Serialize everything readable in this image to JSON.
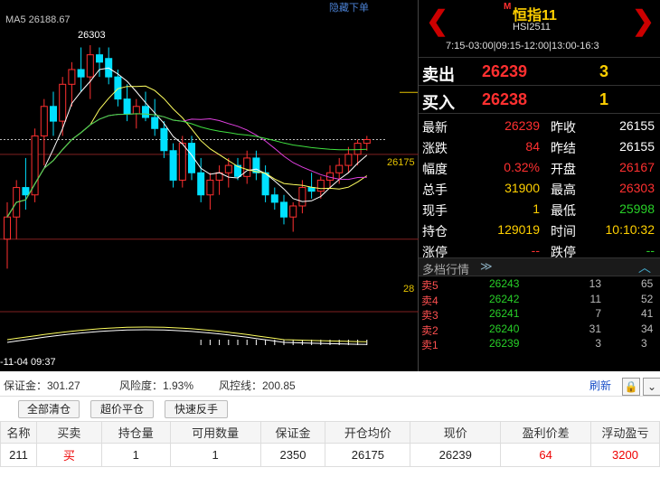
{
  "chart": {
    "ma_label": "MA5 26188.67",
    "hide_order": "隐藏下单",
    "peak": "26303",
    "last": "26175",
    "axis_low": "28",
    "time": "-11-04 09:37"
  },
  "chart_data": {
    "type": "candlestick",
    "candles": [
      [
        26040,
        26090,
        26000,
        26070
      ],
      [
        26070,
        26120,
        26040,
        26110
      ],
      [
        26110,
        26150,
        26080,
        26100
      ],
      [
        26100,
        26190,
        26090,
        26180
      ],
      [
        26180,
        26230,
        26140,
        26220
      ],
      [
        26220,
        26240,
        26180,
        26200
      ],
      [
        26200,
        26260,
        26180,
        26250
      ],
      [
        26250,
        26280,
        26220,
        26270
      ],
      [
        26270,
        26300,
        26240,
        26260
      ],
      [
        26260,
        26303,
        26230,
        26290
      ],
      [
        26290,
        26300,
        26260,
        26280
      ],
      [
        26285,
        26300,
        26250,
        26260
      ],
      [
        26260,
        26270,
        26220,
        26230
      ],
      [
        26230,
        26250,
        26200,
        26210
      ],
      [
        26210,
        26230,
        26190,
        26220
      ],
      [
        26220,
        26240,
        26200,
        26205
      ],
      [
        26205,
        26230,
        26180,
        26190
      ],
      [
        26190,
        26200,
        26150,
        26160
      ],
      [
        26160,
        26170,
        26110,
        26120
      ],
      [
        26120,
        26180,
        26110,
        26170
      ],
      [
        26170,
        26180,
        26120,
        26130
      ],
      [
        26130,
        26150,
        26090,
        26100
      ],
      [
        26100,
        26130,
        26080,
        26120
      ],
      [
        26120,
        26140,
        26100,
        26130
      ],
      [
        26130,
        26150,
        26110,
        26140
      ],
      [
        26140,
        26150,
        26120,
        26125
      ],
      [
        26125,
        26160,
        26115,
        26150
      ],
      [
        26150,
        26160,
        26120,
        26130
      ],
      [
        26130,
        26140,
        26090,
        26100
      ],
      [
        26100,
        26110,
        26080,
        26090
      ],
      [
        26090,
        26100,
        26060,
        26070
      ],
      [
        26070,
        26090,
        26050,
        26085
      ],
      [
        26085,
        26120,
        26075,
        26110
      ],
      [
        26110,
        26130,
        26095,
        26105
      ],
      [
        26105,
        26125,
        26095,
        26120
      ],
      [
        26120,
        26140,
        26110,
        26130
      ],
      [
        26130,
        26150,
        26115,
        26140
      ],
      [
        26140,
        26165,
        26130,
        26155
      ],
      [
        26155,
        26175,
        26140,
        26170
      ],
      [
        26170,
        26180,
        26160,
        26175
      ]
    ]
  },
  "header": {
    "m_badge": "M",
    "name": "恒指11",
    "code": "HSI2511",
    "hours": "7:15-03:00|09:15-12:00|13:00-16:3"
  },
  "ask": {
    "label": "卖出",
    "price": "26239",
    "qty": "3"
  },
  "bid": {
    "label": "买入",
    "price": "26238",
    "qty": "1"
  },
  "stats": [
    {
      "k1": "最新",
      "v1": "26239",
      "c1": "red",
      "k2": "昨收",
      "v2": "26155",
      "c2": "wht"
    },
    {
      "k1": "涨跌",
      "v1": "84",
      "c1": "red",
      "k2": "昨结",
      "v2": "26155",
      "c2": "wht"
    },
    {
      "k1": "幅度",
      "v1": "0.32%",
      "c1": "red",
      "k2": "开盘",
      "v2": "26167",
      "c2": "red"
    },
    {
      "k1": "总手",
      "v1": "31900",
      "c1": "yel",
      "k2": "最高",
      "v2": "26303",
      "c2": "red"
    },
    {
      "k1": "现手",
      "v1": "1",
      "c1": "yel",
      "k2": "最低",
      "v2": "25998",
      "c2": "grn"
    },
    {
      "k1": "持仓",
      "v1": "129019",
      "c1": "yel",
      "k2": "时间",
      "v2": "10:10:32",
      "c2": "yel"
    },
    {
      "k1": "涨停",
      "v1": "--",
      "c1": "red",
      "k2": "跌停",
      "v2": "--",
      "c2": "grn"
    }
  ],
  "depth": {
    "title": "多档行情",
    "rows": [
      {
        "k": "卖5",
        "p": "26243",
        "q1": "13",
        "q2": "65"
      },
      {
        "k": "卖4",
        "p": "26242",
        "q1": "11",
        "q2": "52"
      },
      {
        "k": "卖3",
        "p": "26241",
        "q1": "7",
        "q2": "41"
      },
      {
        "k": "卖2",
        "p": "26240",
        "q1": "31",
        "q2": "34"
      },
      {
        "k": "卖1",
        "p": "26239",
        "q1": "3",
        "q2": "3"
      }
    ]
  },
  "account": {
    "margin": "保证金：301.27",
    "risk": "风险度：1.93%",
    "control": "风控线：200.85",
    "refresh": "刷新"
  },
  "buttons": {
    "close_all": "全部清仓",
    "super_close": "超价平仓",
    "reverse": "快速反手"
  },
  "table": {
    "headers": [
      "名称",
      "买卖",
      "持仓量",
      "可用数量",
      "保证金",
      "开仓均价",
      "现价",
      "盈利价差",
      "浮动盈亏"
    ],
    "row": [
      "211",
      "买",
      "1",
      "1",
      "2350",
      "26175",
      "26239",
      "64",
      "3200"
    ]
  }
}
